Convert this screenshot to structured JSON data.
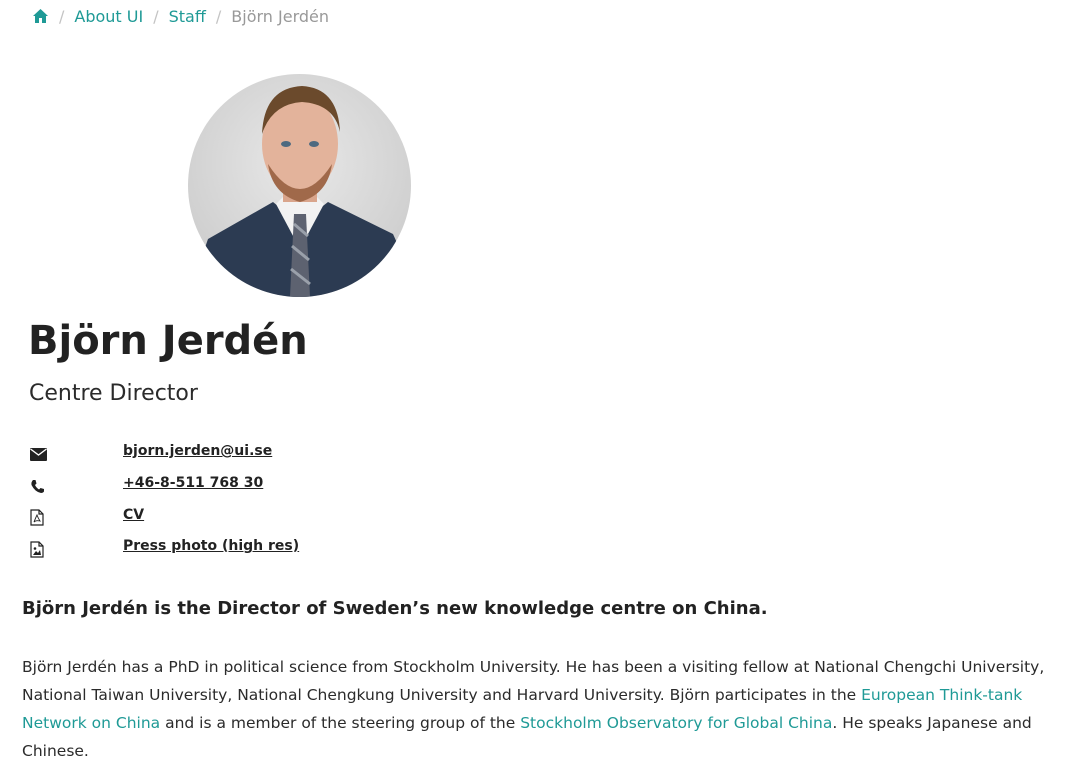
{
  "breadcrumb": {
    "home_icon": "home-icon",
    "items": [
      "About UI",
      "Staff"
    ],
    "current": "Björn Jerdén",
    "separator": "/"
  },
  "profile": {
    "name": "Björn Jerdén",
    "title": "Centre Director",
    "photo_icon": "portrait-photo"
  },
  "contact": {
    "email": "bjorn.jerden@ui.se",
    "phone": "+46-8-511 768 30",
    "cv": "CV",
    "press_photo": "Press photo (high res)",
    "icons": [
      "envelope-icon",
      "phone-icon",
      "pdf-file-icon",
      "image-file-icon"
    ]
  },
  "bio": {
    "lead": "Björn Jerdén is the Director of Sweden’s new knowledge centre on China.",
    "p1_part1": "Björn Jerdén has a PhD in political science from Stockholm University. He has been a visiting fellow at National Chengchi University, National Taiwan University, National Chengkung University and Harvard University. Björn participates in the ",
    "link1": "European Think-tank Network on China",
    "p1_part2": " and is a member of the steering group of the ",
    "link2": "Stockholm Observatory for Global China",
    "p1_part3": ". He speaks Japanese and Chinese."
  },
  "colors": {
    "link": "#1f9a96",
    "text": "#222222",
    "muted": "#999999"
  }
}
